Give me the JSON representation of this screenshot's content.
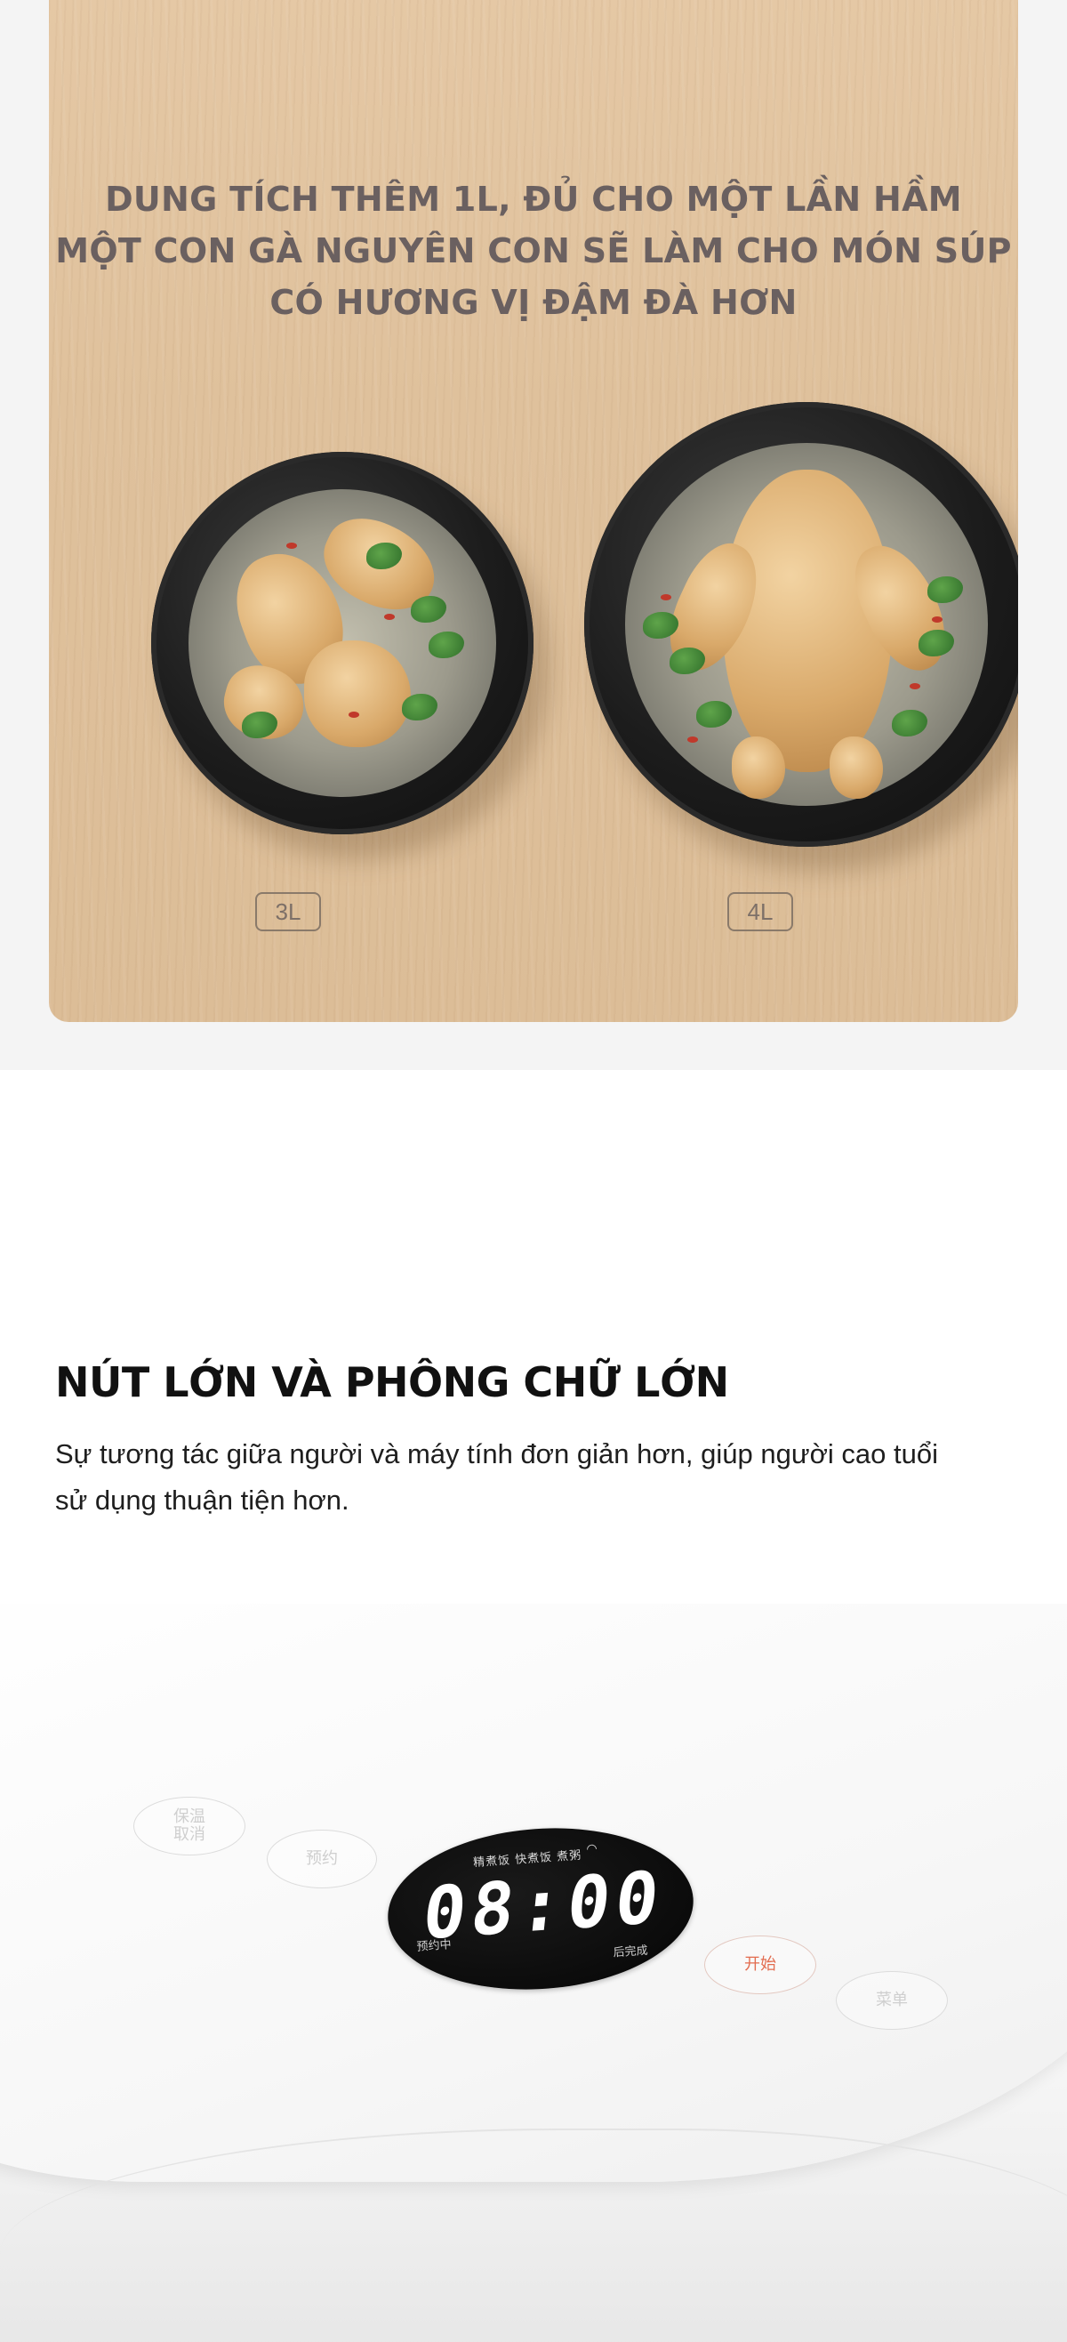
{
  "capacity_section": {
    "headline_lines": [
      "DUNG TÍCH THÊM 1L, ĐỦ CHO MỘT LẦN HẦM",
      "MỘT CON GÀ NGUYÊN CON SẼ LÀM CHO MÓN SÚP",
      "CÓ HƯƠNG VỊ ĐẬM ĐÀ HƠN"
    ],
    "label_small": "3L",
    "label_large": "4L"
  },
  "feature_section": {
    "title": "NÚT LỚN VÀ PHÔNG CHỮ LỚN",
    "description": "Sự tương tác giữa người và máy tính đơn giản hơn, giúp người cao tuổi sử dụng thuận tiện hơn."
  },
  "control_panel": {
    "btn_cancel_line1": "保温",
    "btn_cancel_line2": "取消",
    "btn_reserve": "预约",
    "btn_start": "开始",
    "btn_menu": "菜单",
    "display_modes": "精煮饭  快煮饭  煮粥",
    "display_wifi": "◠",
    "display_time": "08:00",
    "display_left_label": "预约中",
    "display_right_label": "后完成"
  }
}
